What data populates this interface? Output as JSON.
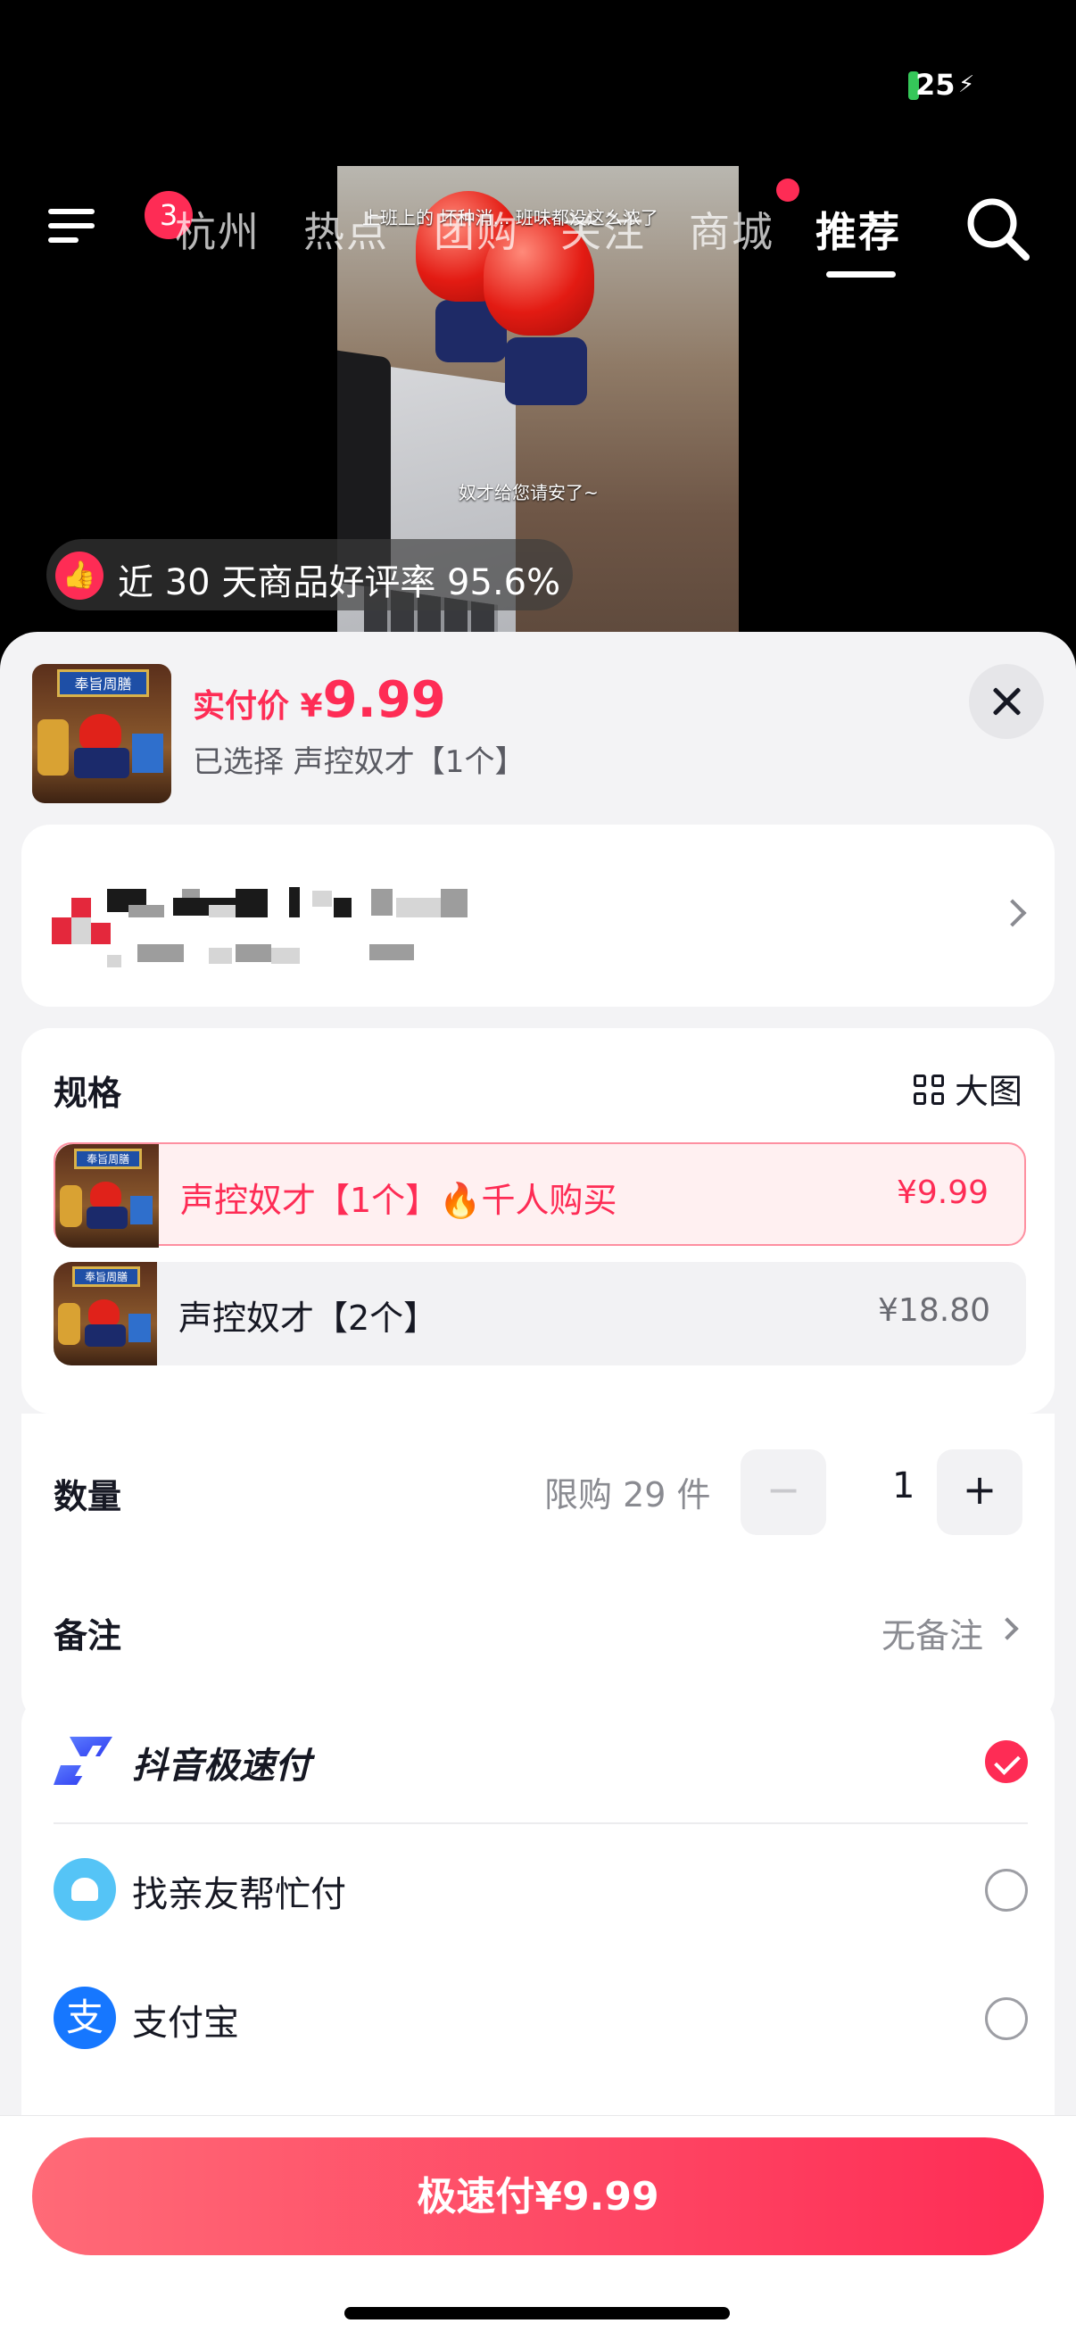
{
  "status": {
    "battery": "25"
  },
  "nav": {
    "badge": "3",
    "items": [
      "杭州",
      "热点",
      "团购",
      "关注",
      "商城",
      "推荐"
    ],
    "active": "推荐"
  },
  "video": {
    "caption_top": "上班上的 坏种消... 班味都没这么浓了",
    "caption_mid": "奴才给您请安了~"
  },
  "rating": {
    "text": "近 30 天商品好评率 95.6%"
  },
  "product": {
    "price_label": "实付价 ¥",
    "price_value": "9.99",
    "selected": "已选择 声控奴才【1个】"
  },
  "spec": {
    "title": "规格",
    "big_view": "大图",
    "options": [
      {
        "name": "声控奴才【1个】",
        "tag": "千人购买",
        "price": "¥9.99",
        "selected": true
      },
      {
        "name": "声控奴才【2个】",
        "tag": "",
        "price": "¥18.80",
        "selected": false
      }
    ]
  },
  "quantity": {
    "label": "数量",
    "limit": "限购 29 件",
    "value": "1",
    "minus": "−",
    "plus": "+"
  },
  "remark": {
    "label": "备注",
    "value": "无备注"
  },
  "payment": {
    "methods": [
      {
        "name": "抖音极速付",
        "selected": true,
        "color": "#3b5bff"
      },
      {
        "name": "找亲友帮忙付",
        "selected": false,
        "color": "#4cc3ff"
      },
      {
        "name": "支付宝",
        "selected": false,
        "color": "#1677ff"
      }
    ]
  },
  "checkout": {
    "button": "极速付¥9.99"
  },
  "colors": {
    "accent": "#fe2c55"
  }
}
